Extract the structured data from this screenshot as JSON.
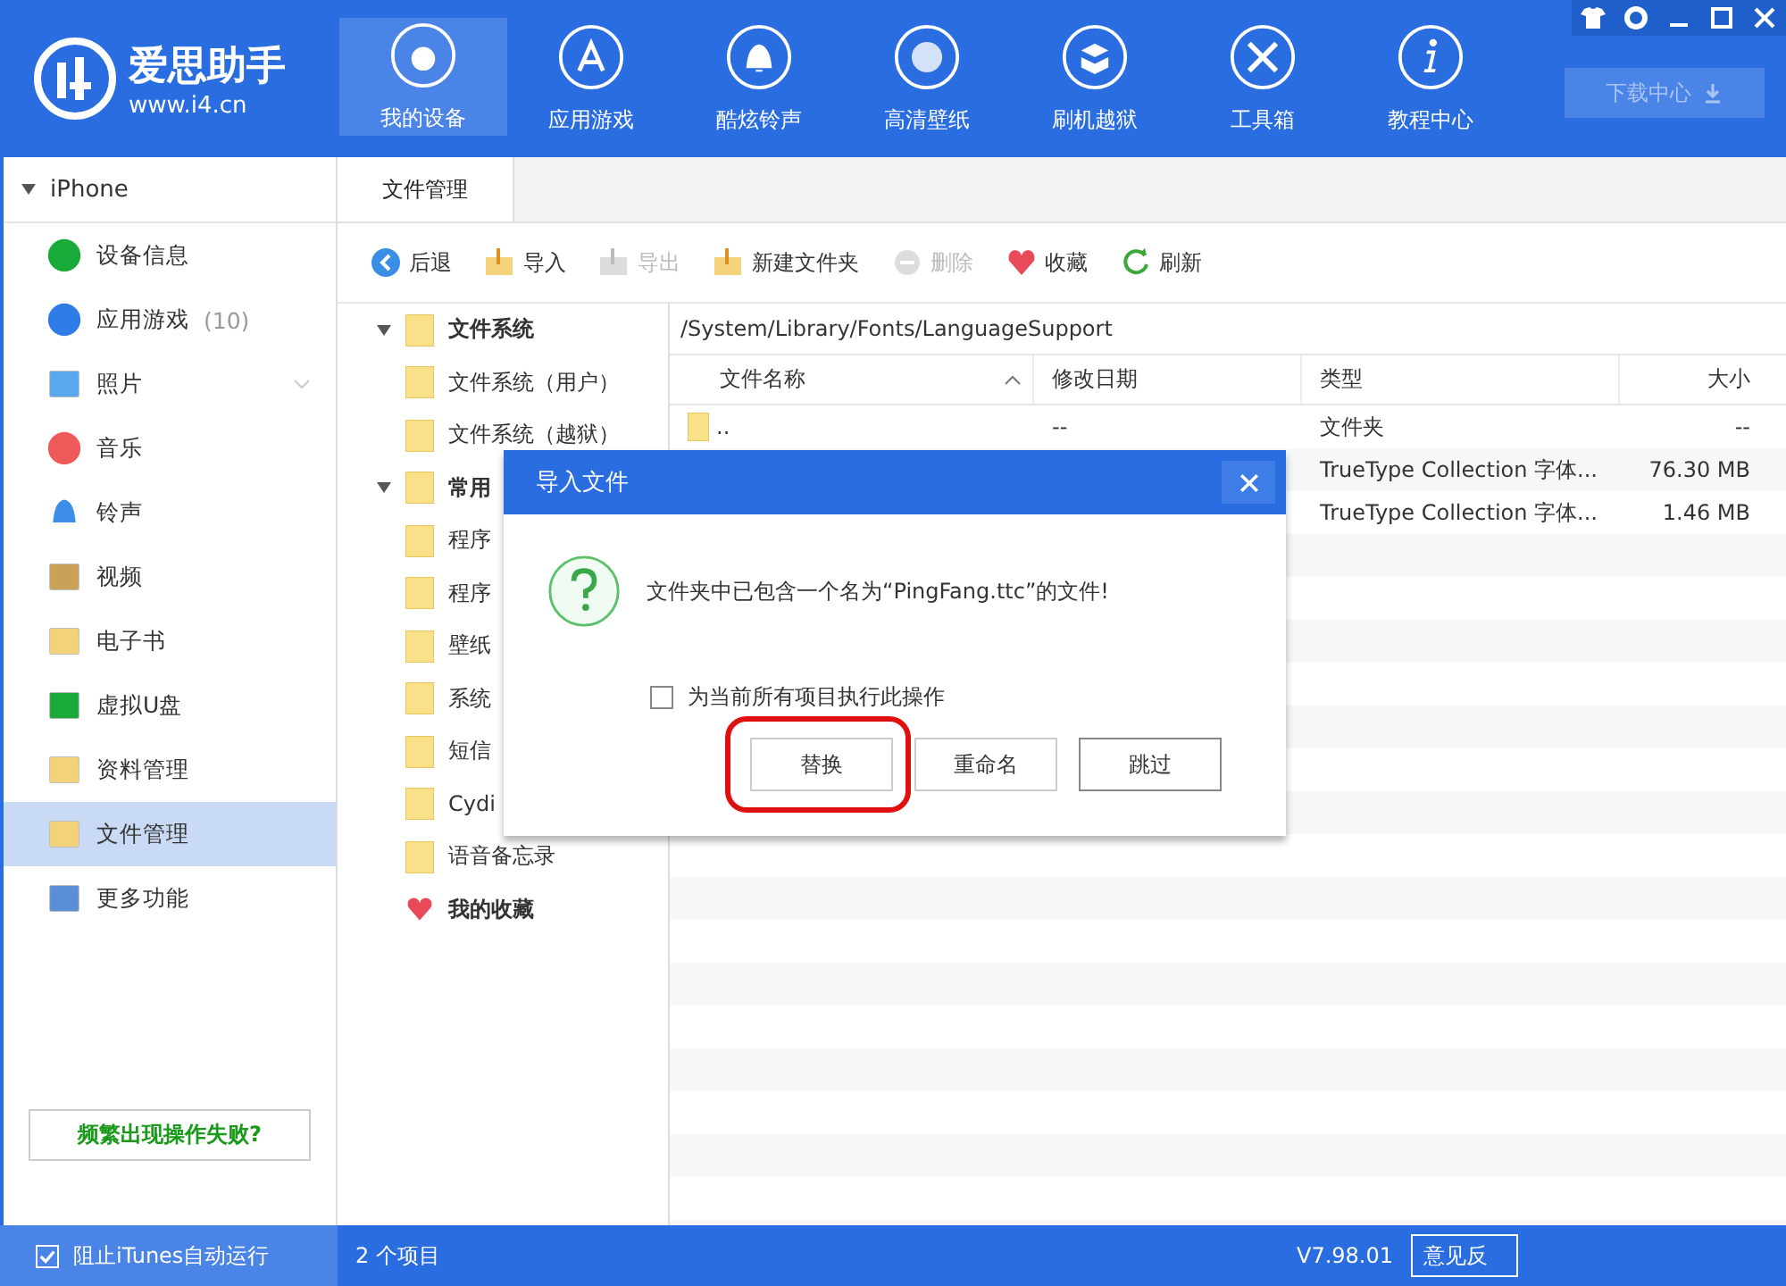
{
  "app": {
    "name": "爱思助手",
    "url": "www.i4.cn"
  },
  "nav": [
    {
      "label": "我的设备",
      "selected": true
    },
    {
      "label": "应用游戏",
      "selected": false
    },
    {
      "label": "酷炫铃声",
      "selected": false
    },
    {
      "label": "高清壁纸",
      "selected": false
    },
    {
      "label": "刷机越狱",
      "selected": false
    },
    {
      "label": "工具箱",
      "selected": false
    },
    {
      "label": "教程中心",
      "selected": false
    }
  ],
  "download_button": "下载中心",
  "device": {
    "name": "iPhone",
    "expanded": true
  },
  "sidebar": {
    "items": [
      {
        "label": "设备信息",
        "selected": false
      },
      {
        "label": "应用游戏",
        "count": "(10)",
        "selected": false
      },
      {
        "label": "照片",
        "selected": false
      },
      {
        "label": "音乐",
        "selected": false
      },
      {
        "label": "铃声",
        "selected": false
      },
      {
        "label": "视频",
        "selected": false
      },
      {
        "label": "电子书",
        "selected": false
      },
      {
        "label": "虚拟U盘",
        "selected": false
      },
      {
        "label": "资料管理",
        "selected": false
      },
      {
        "label": "文件管理",
        "selected": true
      },
      {
        "label": "更多功能",
        "selected": false
      }
    ],
    "help_button": "频繁出现操作失败?"
  },
  "tabs": [
    {
      "label": "文件管理",
      "selected": true
    }
  ],
  "toolbar": [
    {
      "label": "后退",
      "disabled": false
    },
    {
      "label": "导入",
      "disabled": false
    },
    {
      "label": "导出",
      "disabled": true
    },
    {
      "label": "新建文件夹",
      "disabled": false
    },
    {
      "label": "删除",
      "disabled": true
    },
    {
      "label": "收藏",
      "disabled": false
    },
    {
      "label": "刷新",
      "disabled": false
    }
  ],
  "tree": [
    {
      "kind": "folder",
      "label": "文件系统",
      "expanded": true,
      "children": [
        {
          "kind": "folder",
          "label": "文件系统（用户）"
        },
        {
          "kind": "folder",
          "label": "文件系统（越狱）"
        }
      ]
    },
    {
      "kind": "folder",
      "label": "常用",
      "expanded": true,
      "children": [
        {
          "kind": "folder",
          "label": "程序"
        },
        {
          "kind": "folder",
          "label": "程序"
        },
        {
          "kind": "folder",
          "label": "壁纸"
        },
        {
          "kind": "folder",
          "label": "系统"
        },
        {
          "kind": "folder",
          "label": "短信"
        },
        {
          "kind": "folder",
          "label": "Cydi"
        },
        {
          "kind": "folder",
          "label": "语音备忘录"
        }
      ]
    },
    {
      "kind": "favorites",
      "label": "我的收藏"
    }
  ],
  "file_list": {
    "path": "/System/Library/Fonts/LanguageSupport",
    "columns": [
      "文件名称",
      "修改日期",
      "类型",
      "大小"
    ],
    "rows": [
      {
        "name": "..",
        "date": "--",
        "type": "文件夹",
        "size": "--"
      },
      {
        "type": "TrueType Collection 字体...",
        "size": "76.30 MB"
      },
      {
        "type": "TrueType Collection 字体...",
        "size": "1.46 MB"
      }
    ]
  },
  "dialog": {
    "title": "导入文件",
    "message": "文件夹中已包含一个名为“PingFang.ttc”的文件!",
    "apply_all": {
      "label": "为当前所有项目执行此操作",
      "checked": false
    },
    "buttons": [
      {
        "label": "替换",
        "highlighted": true
      },
      {
        "label": "重命名",
        "highlighted": false
      },
      {
        "label": "跳过",
        "highlighted": false
      }
    ]
  },
  "status_bar": {
    "itunes": {
      "label": "阻止iTunes自动运行",
      "checked": true
    },
    "count": "2 个项目",
    "version": "V7.98.01",
    "feedback_button": "意见反"
  }
}
